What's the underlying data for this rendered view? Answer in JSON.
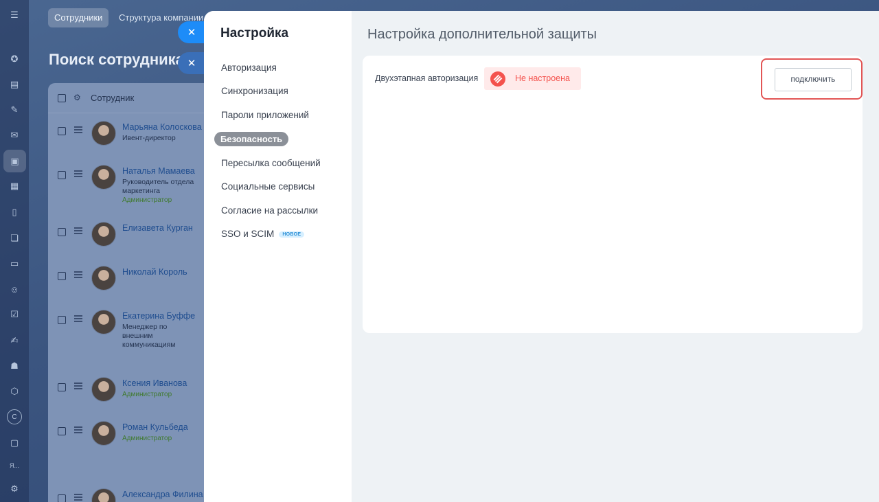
{
  "background": {
    "tabs": [
      "Сотрудники",
      "Структура компании"
    ],
    "title": "Поиск сотрудника",
    "table_header": "Сотрудник",
    "employees": [
      {
        "name": "Марьяна Колоскова",
        "position": "Ивент-директор",
        "role": ""
      },
      {
        "name": "Наталья Мамаева",
        "position": "Руководитель отдела маркетинга",
        "role": "Администратор"
      },
      {
        "name": "Елизавета Курган",
        "position": "",
        "role": ""
      },
      {
        "name": "Николай Король",
        "position": "",
        "role": ""
      },
      {
        "name": "Екатерина Буффе",
        "position": "Менеджер по внешним коммуникациям",
        "role": ""
      },
      {
        "name": "Ксения Иванова",
        "position": "",
        "role": "Администратор"
      },
      {
        "name": "Роман Кульбеда",
        "position": "",
        "role": "Администратор"
      },
      {
        "name": "Александра Филина",
        "position": "",
        "role": ""
      }
    ],
    "rail_letters": [
      "С",
      "Я..."
    ]
  },
  "settings": {
    "title": "Настройка",
    "nav": [
      "Авторизация",
      "Синхронизация",
      "Пароли приложений",
      "Безопасность",
      "Пересылка сообщений",
      "Социальные сервисы",
      "Согласие на рассылки",
      "SSO и SCIM"
    ],
    "new_badge": "НОВОЕ",
    "active_index": 3
  },
  "main": {
    "title": "Настройка дополнительной защиты",
    "field_label": "Двухэтапная авторизация",
    "status": "Не настроена",
    "connect_button": "подключить"
  },
  "colors": {
    "status_red": "#f4524d",
    "highlight_red": "#e25555",
    "close_blue": "#1d8cf8",
    "active_nav": "#8b9098"
  }
}
